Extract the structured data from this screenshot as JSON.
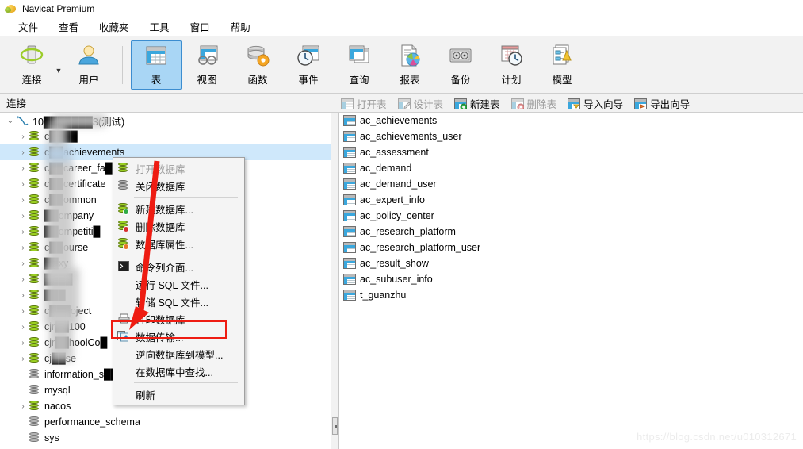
{
  "window": {
    "title": "Navicat Premium",
    "app_icon": "navicat-logo-icon"
  },
  "menubar": {
    "items": [
      {
        "label": "文件",
        "name": "menu-file"
      },
      {
        "label": "查看",
        "name": "menu-view"
      },
      {
        "label": "收藏夹",
        "name": "menu-favorites"
      },
      {
        "label": "工具",
        "name": "menu-tools"
      },
      {
        "label": "窗口",
        "name": "menu-window"
      },
      {
        "label": "帮助",
        "name": "menu-help"
      }
    ]
  },
  "toolbar": {
    "items": [
      {
        "label": "连接",
        "icon": "connection-icon",
        "selected": false
      },
      {
        "label": "用户",
        "icon": "user-icon",
        "selected": false
      },
      {
        "label": "表",
        "icon": "table-icon",
        "selected": true
      },
      {
        "label": "视图",
        "icon": "view-icon",
        "selected": false
      },
      {
        "label": "函数",
        "icon": "function-icon",
        "selected": false
      },
      {
        "label": "事件",
        "icon": "event-icon",
        "selected": false
      },
      {
        "label": "查询",
        "icon": "query-icon",
        "selected": false
      },
      {
        "label": "报表",
        "icon": "report-icon",
        "selected": false
      },
      {
        "label": "备份",
        "icon": "backup-icon",
        "selected": false
      },
      {
        "label": "计划",
        "icon": "schedule-icon",
        "selected": false
      },
      {
        "label": "模型",
        "icon": "model-icon",
        "selected": false
      }
    ]
  },
  "subtoolbar": {
    "connection_label": "连接",
    "actions": [
      {
        "label": "打开表",
        "icon": "open-table-icon",
        "disabled": true
      },
      {
        "label": "设计表",
        "icon": "design-table-icon",
        "disabled": true
      },
      {
        "label": "新建表",
        "icon": "new-table-icon",
        "disabled": false
      },
      {
        "label": "删除表",
        "icon": "delete-table-icon",
        "disabled": true
      },
      {
        "label": "导入向导",
        "icon": "import-wizard-icon",
        "disabled": false
      },
      {
        "label": "导出向导",
        "icon": "export-wizard-icon",
        "disabled": false
      }
    ]
  },
  "tree": {
    "connection": {
      "label": "10███████3(测试)",
      "expanded": true,
      "icon": "mysql-connection-icon"
    },
    "databases": [
      {
        "label": "c████",
        "open": true,
        "expandable": true,
        "selected": false
      },
      {
        "label": "c██achievements",
        "open": true,
        "expandable": true,
        "selected": true
      },
      {
        "label": "c██career_fa█",
        "open": true,
        "expandable": true,
        "selected": false
      },
      {
        "label": "c██certificate",
        "open": true,
        "expandable": true,
        "selected": false
      },
      {
        "label": "c██ommon",
        "open": true,
        "expandable": true,
        "selected": false
      },
      {
        "label": "██ompany",
        "open": true,
        "expandable": true,
        "selected": false
      },
      {
        "label": "██ompetiti█",
        "open": true,
        "expandable": true,
        "selected": false
      },
      {
        "label": "c██ourse",
        "open": true,
        "expandable": true,
        "selected": false
      },
      {
        "label": "██xy",
        "open": true,
        "expandable": true,
        "selected": false
      },
      {
        "label": "████",
        "open": true,
        "expandable": true,
        "selected": false
      },
      {
        "label": "███",
        "open": true,
        "expandable": true,
        "selected": false
      },
      {
        "label": "c███oject",
        "open": true,
        "expandable": true,
        "selected": false
      },
      {
        "label": "cjr██100",
        "open": true,
        "expandable": true,
        "selected": false
      },
      {
        "label": "cjr██hoolCo█",
        "open": true,
        "expandable": true,
        "selected": false
      },
      {
        "label": "cj██se",
        "open": true,
        "expandable": true,
        "selected": false
      },
      {
        "label": "information_s██",
        "open": false,
        "expandable": false,
        "selected": false
      },
      {
        "label": "mysql",
        "open": false,
        "expandable": false,
        "selected": false
      },
      {
        "label": "nacos",
        "open": true,
        "expandable": true,
        "selected": false
      },
      {
        "label": "performance_schema",
        "open": false,
        "expandable": false,
        "selected": false
      },
      {
        "label": "sys",
        "open": false,
        "expandable": false,
        "selected": false
      }
    ]
  },
  "tables": [
    "ac_achievements",
    "ac_achievements_user",
    "ac_assessment",
    "ac_demand",
    "ac_demand_user",
    "ac_expert_info",
    "ac_policy_center",
    "ac_research_platform",
    "ac_research_platform_user",
    "ac_result_show",
    "ac_subuser_info",
    "t_guanzhu"
  ],
  "context_menu": {
    "items": [
      {
        "label": "打开数据库",
        "icon": "open-database-icon",
        "disabled": true,
        "highlighted": false
      },
      {
        "label": "关闭数据库",
        "icon": "close-database-icon",
        "disabled": false,
        "highlighted": false
      },
      {
        "separator": true
      },
      {
        "label": "新建数据库...",
        "icon": "new-database-icon",
        "disabled": false,
        "highlighted": false
      },
      {
        "label": "删除数据库",
        "icon": "delete-database-icon",
        "disabled": false,
        "highlighted": false
      },
      {
        "label": "数据库属性...",
        "icon": "database-properties-icon",
        "disabled": false,
        "highlighted": false
      },
      {
        "separator": true
      },
      {
        "label": "命令列介面...",
        "icon": "console-icon",
        "disabled": false,
        "highlighted": false
      },
      {
        "label": "运行 SQL 文件...",
        "icon": "",
        "disabled": false,
        "highlighted": false
      },
      {
        "label": "转储 SQL 文件...",
        "icon": "",
        "disabled": false,
        "highlighted": false
      },
      {
        "label": "打印数据库",
        "icon": "printer-icon",
        "disabled": false,
        "highlighted": false
      },
      {
        "label": "数据传输...",
        "icon": "data-transfer-icon",
        "disabled": false,
        "highlighted": true
      },
      {
        "label": "逆向数据库到模型...",
        "icon": "",
        "disabled": false,
        "highlighted": false
      },
      {
        "label": "在数据库中查找...",
        "icon": "",
        "disabled": false,
        "highlighted": false
      },
      {
        "separator": true
      },
      {
        "label": "刷新",
        "icon": "",
        "disabled": false,
        "highlighted": false
      }
    ]
  },
  "annotation": {
    "arrow_color": "#ee1c12",
    "highlight_color": "#ee1c12"
  },
  "watermark": {
    "text": "https://blog.csdn.net/u010312671"
  },
  "colors": {
    "selection_blue": "#cfe8fb",
    "toolbar_bg": "#f2f2f2",
    "toolbar_selected": "#a9d6f5",
    "accent_red": "#ee1c12"
  }
}
